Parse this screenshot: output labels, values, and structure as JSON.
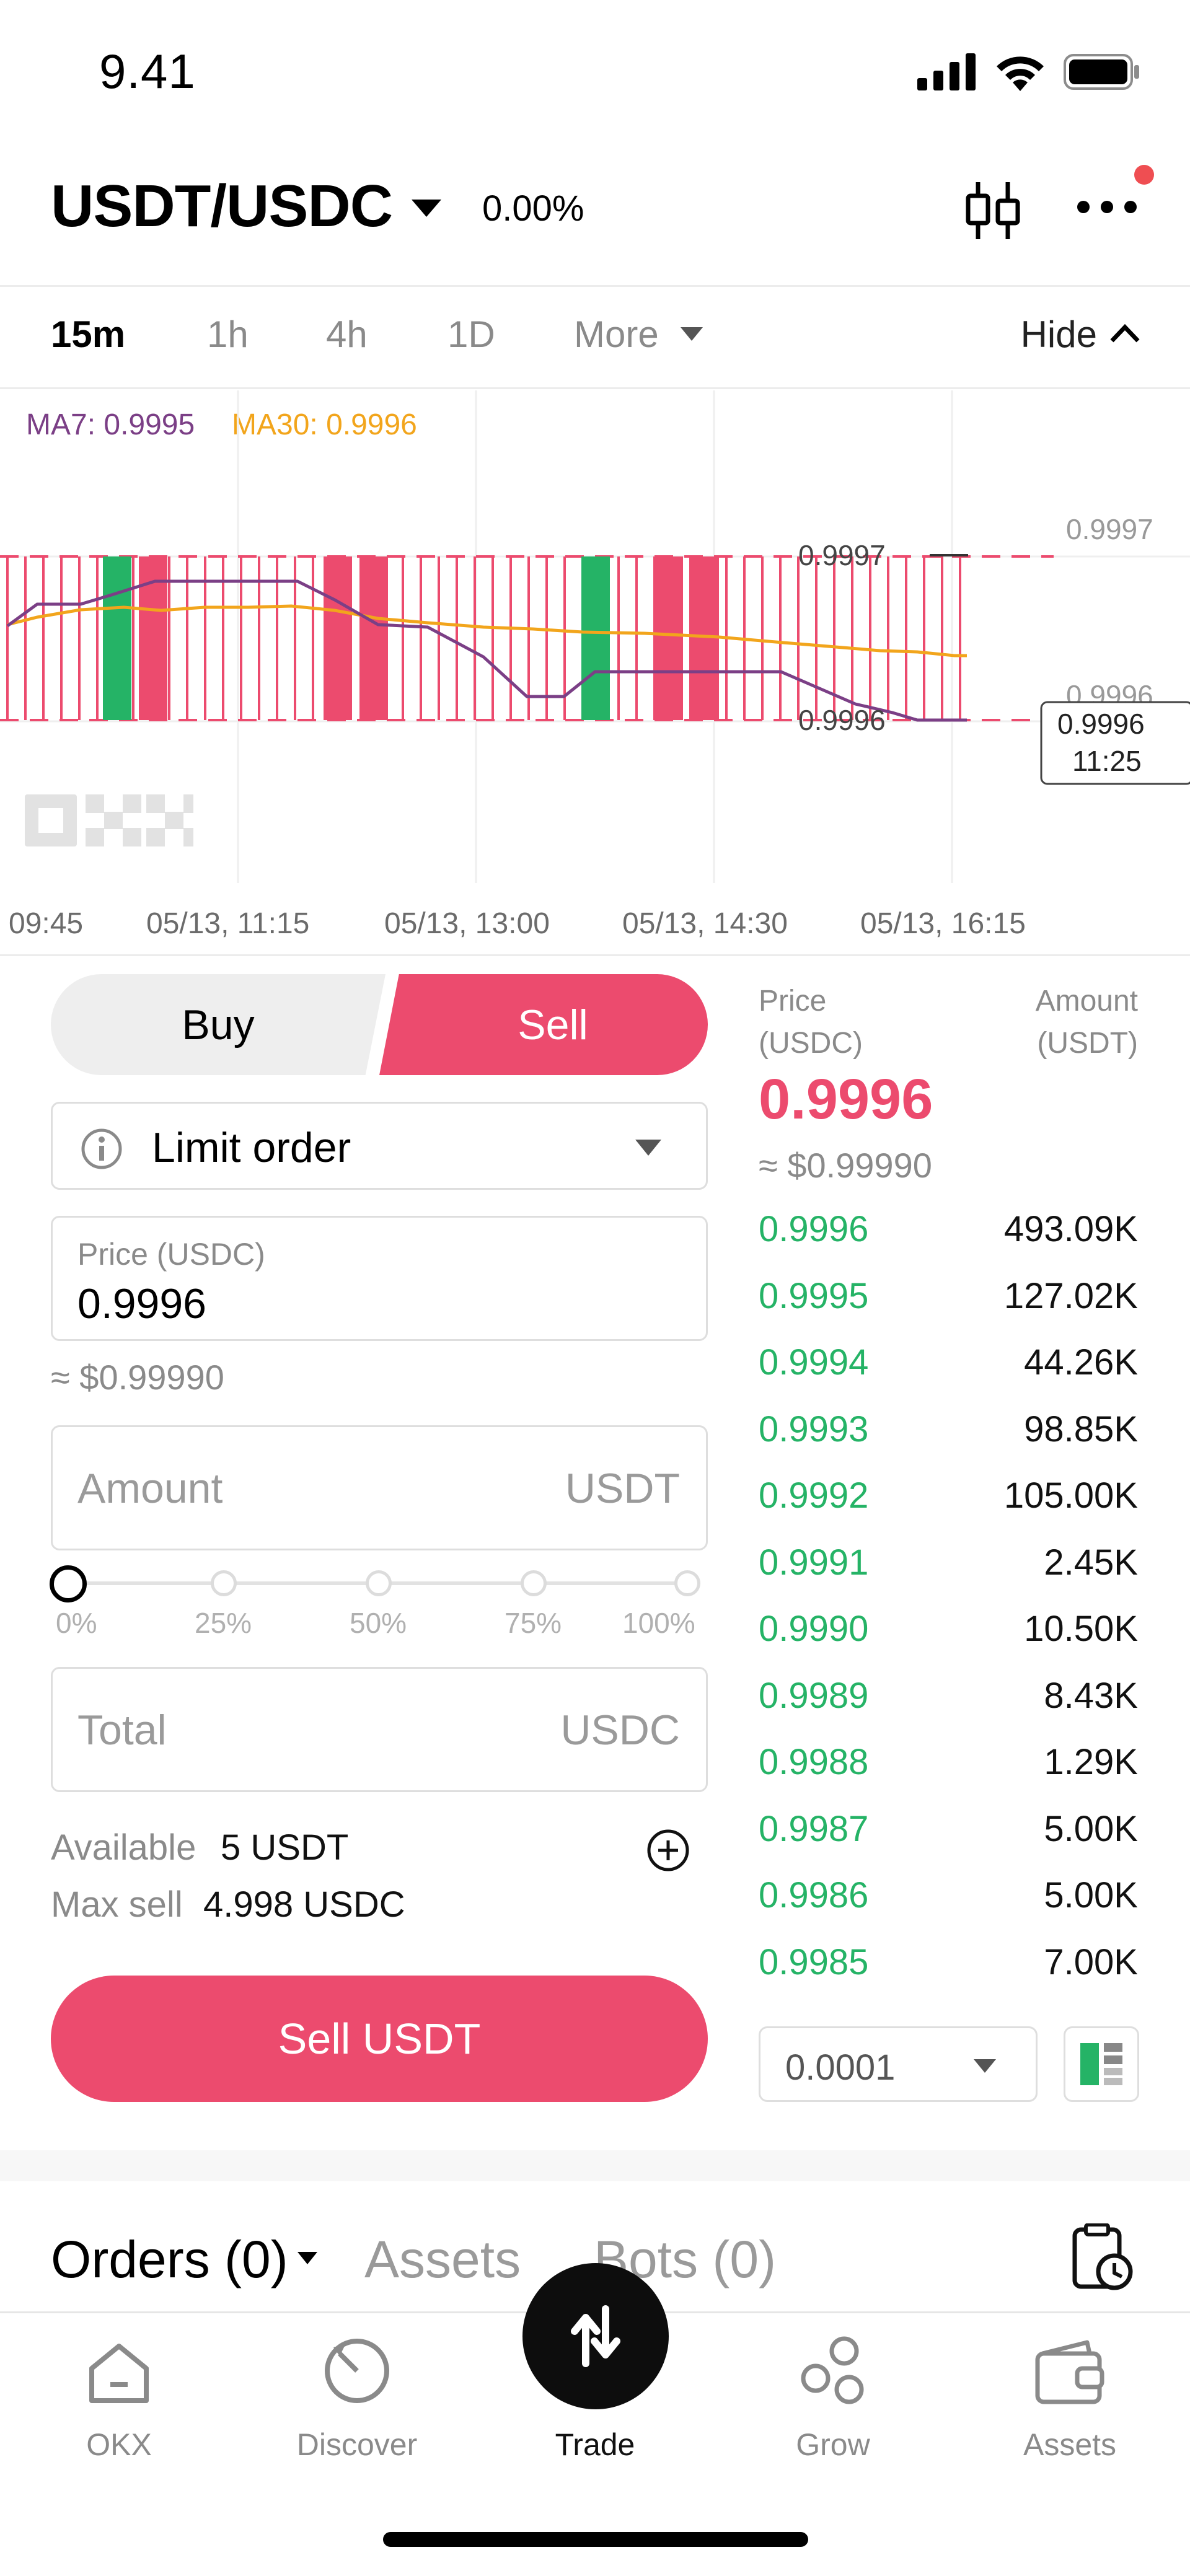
{
  "status_bar": {
    "time": "9.41"
  },
  "header": {
    "pair": "USDT/USDC",
    "change": "0.00%"
  },
  "timeframes": {
    "items": [
      "15m",
      "1h",
      "4h",
      "1D",
      "More"
    ],
    "active": "15m",
    "hide_label": "Hide"
  },
  "chart": {
    "ma7_label": "MA7: 0.9995",
    "ma30_label": "MA30: 0.9996",
    "price_high_marker": "0.9997",
    "price_low_marker": "0.9996",
    "axis_upper": "0.9997",
    "axis_lower": "0.9996",
    "crosshair_price": "0.9996",
    "crosshair_time": "11:25",
    "watermark": "OKX",
    "x_ticks": [
      "09:45",
      "05/13, 11:15",
      "05/13, 13:00",
      "05/13, 14:30",
      "05/13, 16:15"
    ],
    "colors": {
      "up": "#25b366",
      "down": "#ec4b6e",
      "ma7": "#7b3f86",
      "ma30": "#f2a51c"
    }
  },
  "trade_form": {
    "buy_label": "Buy",
    "sell_label": "Sell",
    "order_type": "Limit order",
    "price_label": "Price (USDC)",
    "price_value": "0.9996",
    "price_approx": "≈ $0.99990",
    "amount_placeholder": "Amount",
    "amount_unit": "USDT",
    "slider_marks": [
      "0%",
      "25%",
      "50%",
      "75%",
      "100%"
    ],
    "total_placeholder": "Total",
    "total_unit": "USDC",
    "available_label": "Available",
    "available_value": "5 USDT",
    "max_sell_label": "Max sell",
    "max_sell_value": "4.998 USDC",
    "submit_label": "Sell USDT"
  },
  "order_book": {
    "price_header": "Price\n(USDC)",
    "price_header_1": "Price",
    "price_header_2": "(USDC)",
    "amount_header_1": "Amount",
    "amount_header_2": "(USDT)",
    "last_price": "0.9996",
    "last_price_usd": "≈ $0.99990",
    "rows": [
      {
        "price": "0.9996",
        "amount": "493.09K"
      },
      {
        "price": "0.9995",
        "amount": "127.02K"
      },
      {
        "price": "0.9994",
        "amount": "44.26K"
      },
      {
        "price": "0.9993",
        "amount": "98.85K"
      },
      {
        "price": "0.9992",
        "amount": "105.00K"
      },
      {
        "price": "0.9991",
        "amount": "2.45K"
      },
      {
        "price": "0.9990",
        "amount": "10.50K"
      },
      {
        "price": "0.9989",
        "amount": "8.43K"
      },
      {
        "price": "0.9988",
        "amount": "1.29K"
      },
      {
        "price": "0.9987",
        "amount": "5.00K"
      },
      {
        "price": "0.9986",
        "amount": "5.00K"
      },
      {
        "price": "0.9985",
        "amount": "7.00K"
      }
    ],
    "tick_size": "0.0001"
  },
  "bottom_tabs": {
    "orders": "Orders (0)",
    "assets": "Assets",
    "bots": "Bots (0)"
  },
  "nav": {
    "items": [
      "OKX",
      "Discover",
      "Trade",
      "Grow",
      "Assets"
    ],
    "active": "Trade"
  }
}
